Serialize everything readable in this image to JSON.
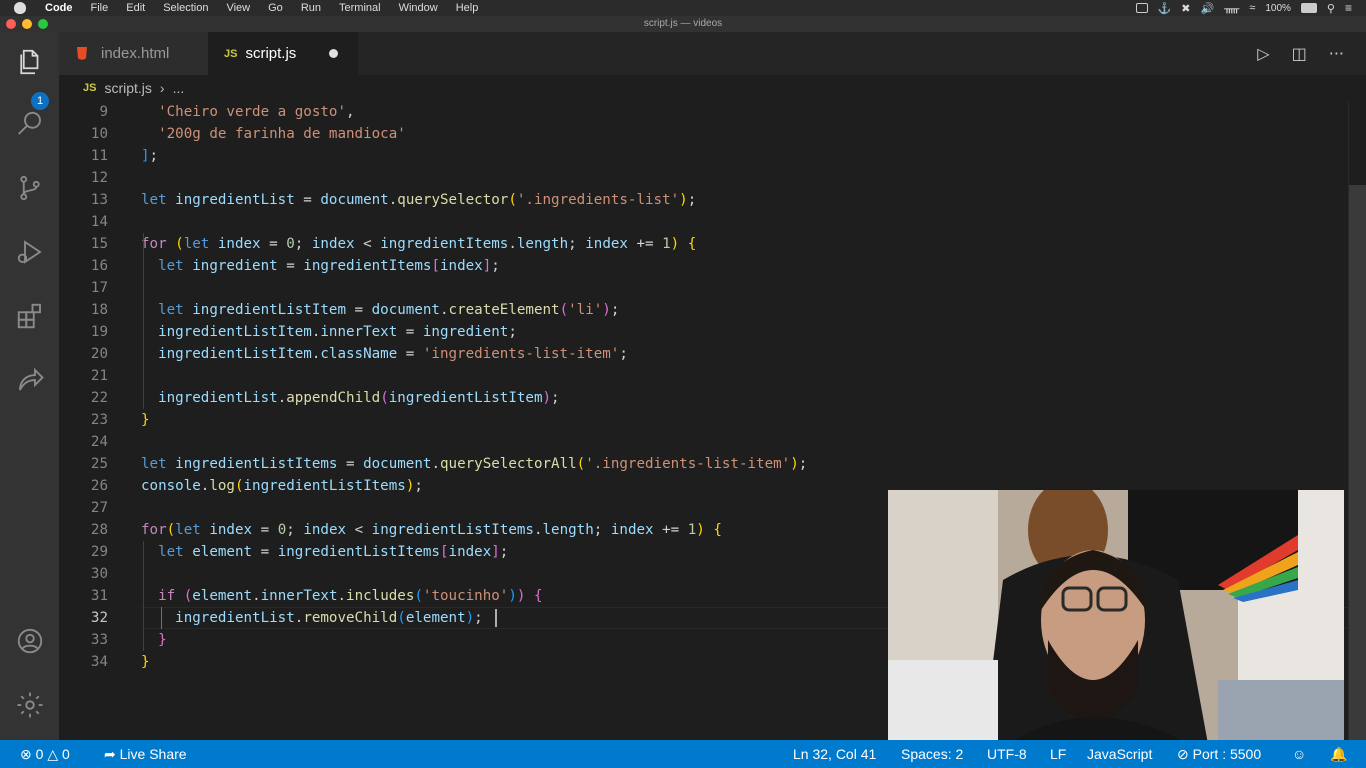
{
  "menubar": {
    "items": [
      "Code",
      "File",
      "Edit",
      "Selection",
      "View",
      "Go",
      "Run",
      "Terminal",
      "Window",
      "Help"
    ],
    "battery": "100%",
    "icons": [
      "screen-record-icon",
      "docker-icon",
      "app-icon",
      "volume-icon",
      "bluetooth-icon",
      "wifi-icon",
      "battery-icon",
      "search-icon",
      "menu-icon"
    ]
  },
  "window": {
    "title": "script.js — videos"
  },
  "activity": {
    "explorer_badge": "1"
  },
  "tabs": [
    {
      "label": "index.html",
      "icon": "html5-icon",
      "active": false
    },
    {
      "label": "script.js",
      "icon": "js-icon",
      "active": true,
      "dirty": true
    }
  ],
  "breadcrumb": {
    "file": "script.js",
    "rest": "..."
  },
  "editor": {
    "lines": [
      {
        "n": "9",
        "tokens": [
          [
            "p",
            "  "
          ],
          [
            "s",
            "'Cheiro verde a gosto'"
          ],
          [
            "p",
            ","
          ]
        ]
      },
      {
        "n": "10",
        "tokens": [
          [
            "p",
            "  "
          ],
          [
            "s",
            "'200g de farinha de mandioca'"
          ]
        ]
      },
      {
        "n": "11",
        "tokens": [
          [
            "b3",
            "]"
          ],
          [
            "p",
            ";"
          ]
        ]
      },
      {
        "n": "12",
        "tokens": []
      },
      {
        "n": "13",
        "tokens": [
          [
            "k",
            "let "
          ],
          [
            "v",
            "ingredientList"
          ],
          [
            "p",
            " = "
          ],
          [
            "v",
            "document"
          ],
          [
            "p",
            "."
          ],
          [
            "f",
            "querySelector"
          ],
          [
            "b1",
            "("
          ],
          [
            "s",
            "'.ingredients-list'"
          ],
          [
            "b1",
            ")"
          ],
          [
            "p",
            ";"
          ]
        ]
      },
      {
        "n": "14",
        "tokens": []
      },
      {
        "n": "15",
        "tokens": [
          [
            "kc",
            "for "
          ],
          [
            "b1",
            "("
          ],
          [
            "k",
            "let "
          ],
          [
            "v",
            "index"
          ],
          [
            "p",
            " = "
          ],
          [
            "n",
            "0"
          ],
          [
            "p",
            "; "
          ],
          [
            "v",
            "index"
          ],
          [
            "p",
            " < "
          ],
          [
            "v",
            "ingredientItems"
          ],
          [
            "p",
            "."
          ],
          [
            "v",
            "length"
          ],
          [
            "p",
            "; "
          ],
          [
            "v",
            "index"
          ],
          [
            "p",
            " += "
          ],
          [
            "n",
            "1"
          ],
          [
            "b1",
            ")"
          ],
          [
            "p",
            " "
          ],
          [
            "b1",
            "{"
          ]
        ]
      },
      {
        "n": "16",
        "tokens": [
          [
            "p",
            "  "
          ],
          [
            "k",
            "let "
          ],
          [
            "v",
            "ingredient"
          ],
          [
            "p",
            " = "
          ],
          [
            "v",
            "ingredientItems"
          ],
          [
            "b2",
            "["
          ],
          [
            "v",
            "index"
          ],
          [
            "b2",
            "]"
          ],
          [
            "p",
            ";"
          ]
        ]
      },
      {
        "n": "17",
        "tokens": []
      },
      {
        "n": "18",
        "tokens": [
          [
            "p",
            "  "
          ],
          [
            "k",
            "let "
          ],
          [
            "v",
            "ingredientListItem"
          ],
          [
            "p",
            " = "
          ],
          [
            "v",
            "document"
          ],
          [
            "p",
            "."
          ],
          [
            "f",
            "createElement"
          ],
          [
            "b2",
            "("
          ],
          [
            "s",
            "'li'"
          ],
          [
            "b2",
            ")"
          ],
          [
            "p",
            ";"
          ]
        ]
      },
      {
        "n": "19",
        "tokens": [
          [
            "p",
            "  "
          ],
          [
            "v",
            "ingredientListItem"
          ],
          [
            "p",
            "."
          ],
          [
            "v",
            "innerText"
          ],
          [
            "p",
            " = "
          ],
          [
            "v",
            "ingredient"
          ],
          [
            "p",
            ";"
          ]
        ]
      },
      {
        "n": "20",
        "tokens": [
          [
            "p",
            "  "
          ],
          [
            "v",
            "ingredientListItem"
          ],
          [
            "p",
            "."
          ],
          [
            "v",
            "className"
          ],
          [
            "p",
            " = "
          ],
          [
            "s",
            "'ingredients-list-item'"
          ],
          [
            "p",
            ";"
          ]
        ]
      },
      {
        "n": "21",
        "tokens": []
      },
      {
        "n": "22",
        "tokens": [
          [
            "p",
            "  "
          ],
          [
            "v",
            "ingredientList"
          ],
          [
            "p",
            "."
          ],
          [
            "f",
            "appendChild"
          ],
          [
            "b2",
            "("
          ],
          [
            "v",
            "ingredientListItem"
          ],
          [
            "b2",
            ")"
          ],
          [
            "p",
            ";"
          ]
        ]
      },
      {
        "n": "23",
        "tokens": [
          [
            "b1",
            "}"
          ]
        ]
      },
      {
        "n": "24",
        "tokens": []
      },
      {
        "n": "25",
        "tokens": [
          [
            "k",
            "let "
          ],
          [
            "v",
            "ingredientListItems"
          ],
          [
            "p",
            " = "
          ],
          [
            "v",
            "document"
          ],
          [
            "p",
            "."
          ],
          [
            "f",
            "querySelectorAll"
          ],
          [
            "b1",
            "("
          ],
          [
            "s",
            "'.ingredients-list-item'"
          ],
          [
            "b1",
            ")"
          ],
          [
            "p",
            ";"
          ]
        ]
      },
      {
        "n": "26",
        "tokens": [
          [
            "v",
            "console"
          ],
          [
            "p",
            "."
          ],
          [
            "f",
            "log"
          ],
          [
            "b1",
            "("
          ],
          [
            "v",
            "ingredientListItems"
          ],
          [
            "b1",
            ")"
          ],
          [
            "p",
            ";"
          ]
        ]
      },
      {
        "n": "27",
        "tokens": []
      },
      {
        "n": "28",
        "tokens": [
          [
            "kc",
            "for"
          ],
          [
            "b1",
            "("
          ],
          [
            "k",
            "let "
          ],
          [
            "v",
            "index"
          ],
          [
            "p",
            " = "
          ],
          [
            "n",
            "0"
          ],
          [
            "p",
            "; "
          ],
          [
            "v",
            "index"
          ],
          [
            "p",
            " < "
          ],
          [
            "v",
            "ingredientListItems"
          ],
          [
            "p",
            "."
          ],
          [
            "v",
            "length"
          ],
          [
            "p",
            "; "
          ],
          [
            "v",
            "index"
          ],
          [
            "p",
            " += "
          ],
          [
            "n",
            "1"
          ],
          [
            "b1",
            ")"
          ],
          [
            "p",
            " "
          ],
          [
            "b1",
            "{"
          ]
        ]
      },
      {
        "n": "29",
        "tokens": [
          [
            "p",
            "  "
          ],
          [
            "k",
            "let "
          ],
          [
            "v",
            "element"
          ],
          [
            "p",
            " = "
          ],
          [
            "v",
            "ingredientListItems"
          ],
          [
            "b2",
            "["
          ],
          [
            "v",
            "index"
          ],
          [
            "b2",
            "]"
          ],
          [
            "p",
            ";"
          ]
        ]
      },
      {
        "n": "30",
        "tokens": []
      },
      {
        "n": "31",
        "tokens": [
          [
            "p",
            "  "
          ],
          [
            "kc",
            "if "
          ],
          [
            "b2",
            "("
          ],
          [
            "v",
            "element"
          ],
          [
            "p",
            "."
          ],
          [
            "v",
            "innerText"
          ],
          [
            "p",
            "."
          ],
          [
            "f",
            "includes"
          ],
          [
            "b3",
            "("
          ],
          [
            "s",
            "'toucinho'"
          ],
          [
            "b3",
            ")"
          ],
          [
            "b2",
            ")"
          ],
          [
            "p",
            " "
          ],
          [
            "b2",
            "{"
          ]
        ]
      },
      {
        "n": "32",
        "tokens": [
          [
            "p",
            "    "
          ],
          [
            "v",
            "ingredientList"
          ],
          [
            "p",
            "."
          ],
          [
            "f",
            "removeChild"
          ],
          [
            "b3",
            "("
          ],
          [
            "v",
            "element"
          ],
          [
            "b3",
            ")"
          ],
          [
            "p",
            ";"
          ]
        ]
      },
      {
        "n": "33",
        "tokens": [
          [
            "p",
            "  "
          ],
          [
            "b2",
            "}"
          ]
        ]
      },
      {
        "n": "34",
        "tokens": [
          [
            "b1",
            "}"
          ]
        ]
      }
    ]
  },
  "statusbar": {
    "errors": "0",
    "warnings": "0",
    "live_share": "Live Share",
    "position": "Ln 32, Col 41",
    "spaces": "Spaces: 2",
    "encoding": "UTF-8",
    "eol": "LF",
    "language": "JavaScript",
    "port": "Port : 5500"
  }
}
